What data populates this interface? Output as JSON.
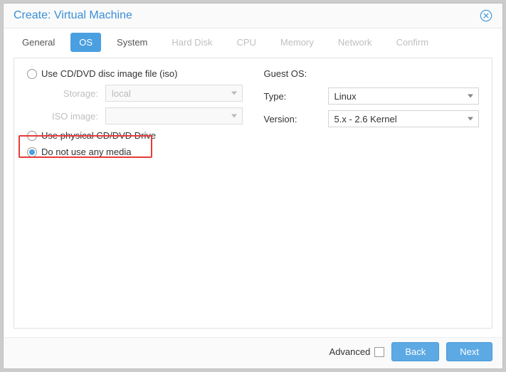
{
  "dialog": {
    "title": "Create: Virtual Machine"
  },
  "tabs": {
    "general": "General",
    "os": "OS",
    "system": "System",
    "hard_disk": "Hard Disk",
    "cpu": "CPU",
    "memory": "Memory",
    "network": "Network",
    "confirm": "Confirm"
  },
  "radio": {
    "iso": "Use CD/DVD disc image file (iso)",
    "physical": "Use physical CD/DVD Drive",
    "none": "Do not use any media"
  },
  "labels": {
    "storage": "Storage:",
    "iso_image": "ISO image:",
    "guest_os": "Guest OS:",
    "type": "Type:",
    "version": "Version:",
    "advanced": "Advanced"
  },
  "values": {
    "storage": "local",
    "iso_image": "",
    "type": "Linux",
    "version": "5.x - 2.6 Kernel"
  },
  "buttons": {
    "back": "Back",
    "next": "Next"
  }
}
